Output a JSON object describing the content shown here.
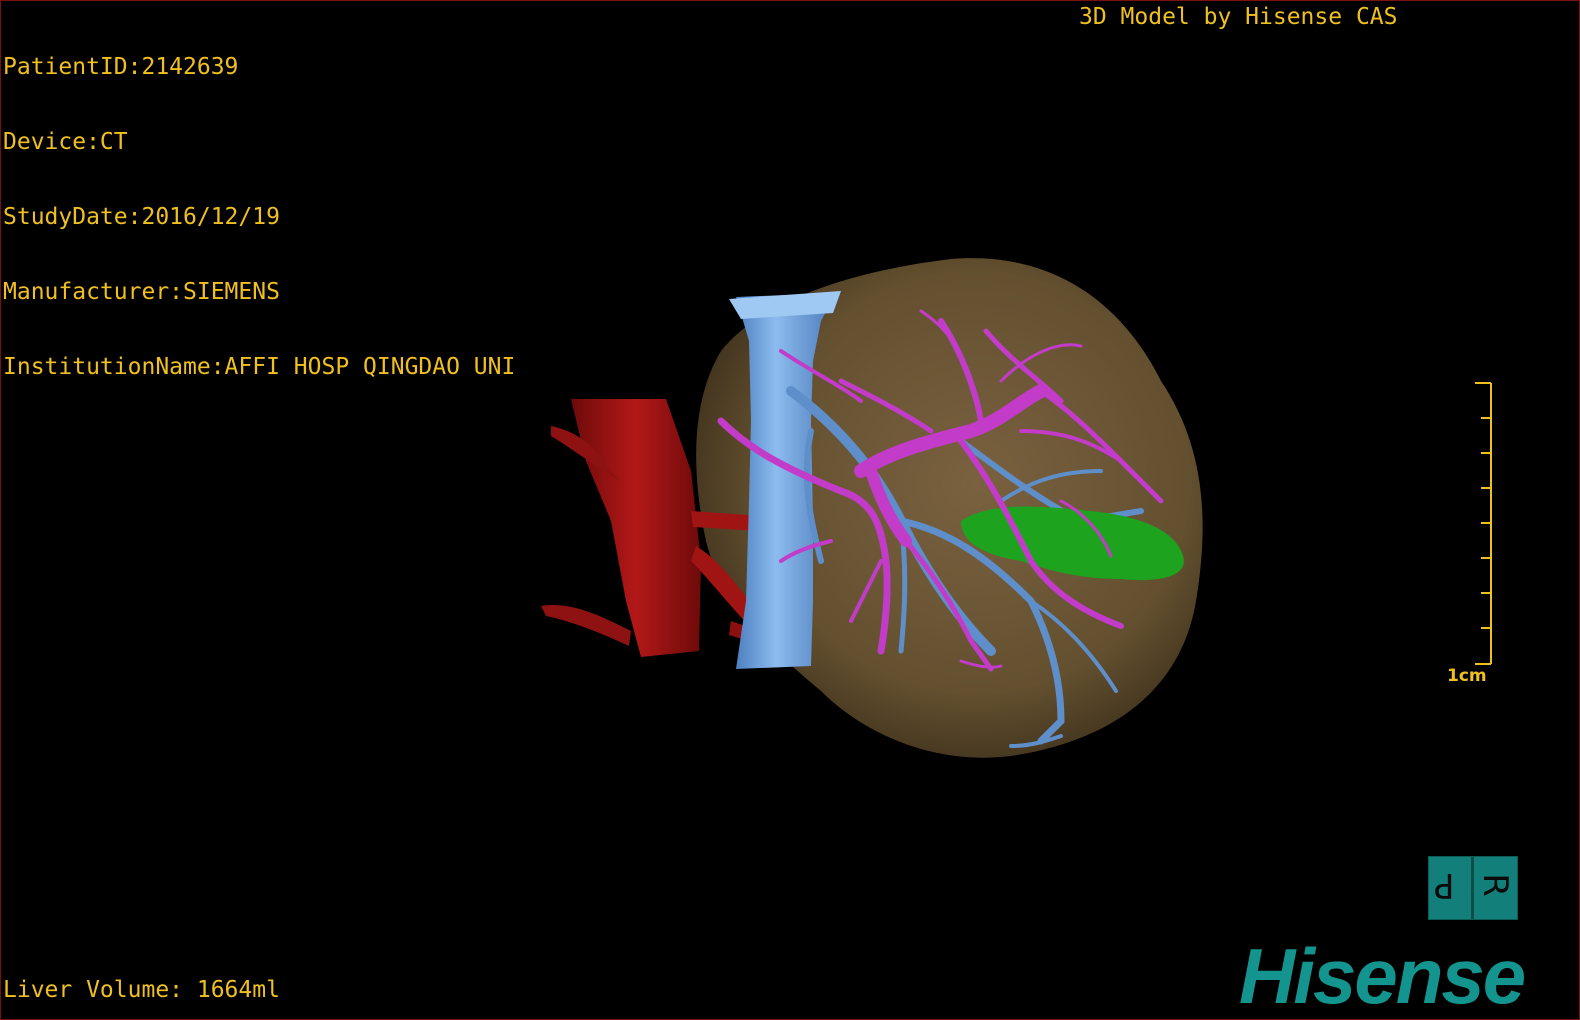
{
  "header": {
    "patient_id": "PatientID:2142639",
    "device": "Device:CT",
    "study_date": "StudyDate:2016/12/19",
    "manufacturer": "Manufacturer:SIEMENS",
    "institution": "InstitutionName:AFFI HOSP QINGDAO UNI",
    "credit": "3D Model by Hisense CAS"
  },
  "footer": {
    "liver_volume": "Liver Volume: 1664ml"
  },
  "scale_bar": {
    "label": "1cm"
  },
  "orientation_cube": {
    "face_left": "P",
    "face_right": "R"
  },
  "brand": {
    "name": "Hisense"
  },
  "colors": {
    "overlay_text": "#f0c020",
    "liver": "#6b5538",
    "aorta": "#9c1010",
    "vena_cava": "#6a9fd8",
    "portal_vein": "#c33bc9",
    "hepatic_vein": "#5e8fca",
    "lesion": "#1c9e1c",
    "brand": "#14948f"
  },
  "icons": [
    "orientation-cube-icon",
    "hisense-logo"
  ]
}
